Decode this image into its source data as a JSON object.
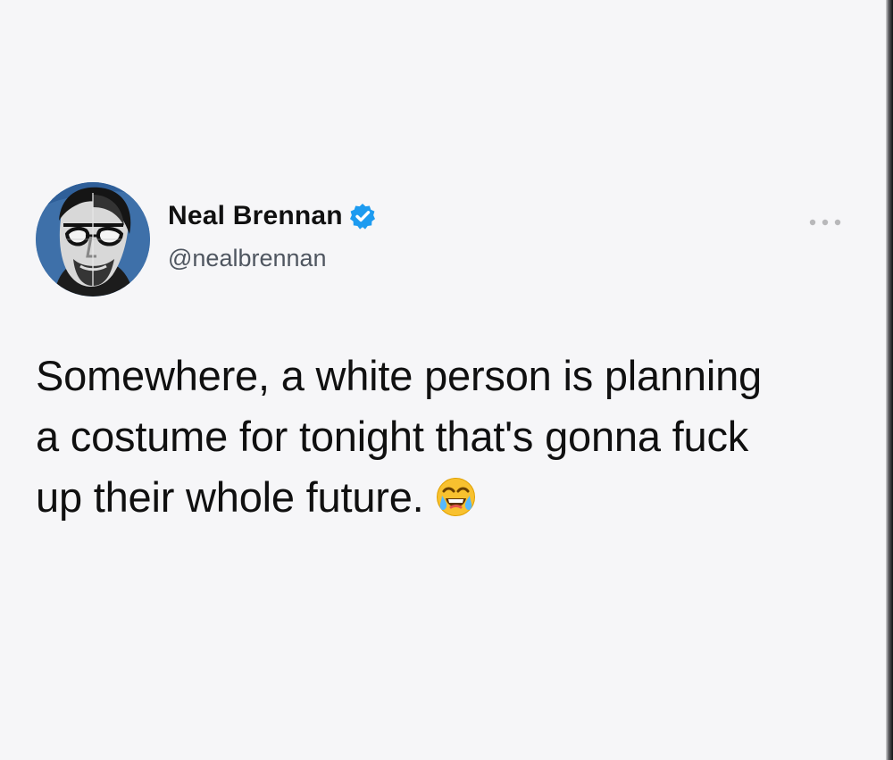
{
  "tweet": {
    "author": {
      "display_name": "Neal Brennan",
      "handle": "@nealbrennan",
      "verified": true,
      "avatar_icon": "profile-photo-icon"
    },
    "text_lines": [
      "Somewhere, a white person is planning",
      "a costume for tonight that's gonna fuck",
      "up their whole future."
    ],
    "emoji": "face-with-tears-of-joy",
    "more_icon": "more-options-icon",
    "colors": {
      "verified_blue": "#1d9bf0",
      "background": "#f6f6f8",
      "text": "#101010",
      "handle": "#4f5660",
      "emoji_yellow": "#f8c12f"
    }
  }
}
